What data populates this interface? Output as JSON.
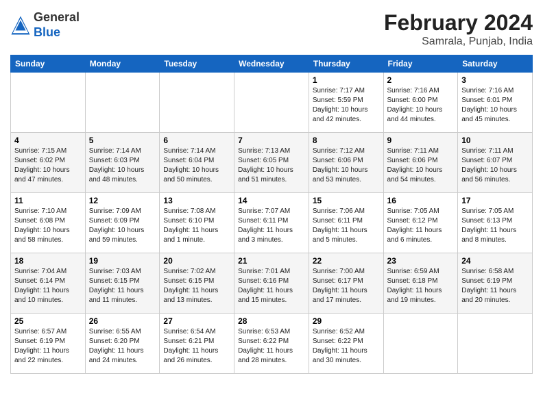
{
  "header": {
    "logo_line1": "General",
    "logo_line2": "Blue",
    "month_year": "February 2024",
    "location": "Samrala, Punjab, India"
  },
  "weekdays": [
    "Sunday",
    "Monday",
    "Tuesday",
    "Wednesday",
    "Thursday",
    "Friday",
    "Saturday"
  ],
  "weeks": [
    [
      {
        "day": "",
        "info": ""
      },
      {
        "day": "",
        "info": ""
      },
      {
        "day": "",
        "info": ""
      },
      {
        "day": "",
        "info": ""
      },
      {
        "day": "1",
        "info": "Sunrise: 7:17 AM\nSunset: 5:59 PM\nDaylight: 10 hours\nand 42 minutes."
      },
      {
        "day": "2",
        "info": "Sunrise: 7:16 AM\nSunset: 6:00 PM\nDaylight: 10 hours\nand 44 minutes."
      },
      {
        "day": "3",
        "info": "Sunrise: 7:16 AM\nSunset: 6:01 PM\nDaylight: 10 hours\nand 45 minutes."
      }
    ],
    [
      {
        "day": "4",
        "info": "Sunrise: 7:15 AM\nSunset: 6:02 PM\nDaylight: 10 hours\nand 47 minutes."
      },
      {
        "day": "5",
        "info": "Sunrise: 7:14 AM\nSunset: 6:03 PM\nDaylight: 10 hours\nand 48 minutes."
      },
      {
        "day": "6",
        "info": "Sunrise: 7:14 AM\nSunset: 6:04 PM\nDaylight: 10 hours\nand 50 minutes."
      },
      {
        "day": "7",
        "info": "Sunrise: 7:13 AM\nSunset: 6:05 PM\nDaylight: 10 hours\nand 51 minutes."
      },
      {
        "day": "8",
        "info": "Sunrise: 7:12 AM\nSunset: 6:06 PM\nDaylight: 10 hours\nand 53 minutes."
      },
      {
        "day": "9",
        "info": "Sunrise: 7:11 AM\nSunset: 6:06 PM\nDaylight: 10 hours\nand 54 minutes."
      },
      {
        "day": "10",
        "info": "Sunrise: 7:11 AM\nSunset: 6:07 PM\nDaylight: 10 hours\nand 56 minutes."
      }
    ],
    [
      {
        "day": "11",
        "info": "Sunrise: 7:10 AM\nSunset: 6:08 PM\nDaylight: 10 hours\nand 58 minutes."
      },
      {
        "day": "12",
        "info": "Sunrise: 7:09 AM\nSunset: 6:09 PM\nDaylight: 10 hours\nand 59 minutes."
      },
      {
        "day": "13",
        "info": "Sunrise: 7:08 AM\nSunset: 6:10 PM\nDaylight: 11 hours\nand 1 minute."
      },
      {
        "day": "14",
        "info": "Sunrise: 7:07 AM\nSunset: 6:11 PM\nDaylight: 11 hours\nand 3 minutes."
      },
      {
        "day": "15",
        "info": "Sunrise: 7:06 AM\nSunset: 6:11 PM\nDaylight: 11 hours\nand 5 minutes."
      },
      {
        "day": "16",
        "info": "Sunrise: 7:05 AM\nSunset: 6:12 PM\nDaylight: 11 hours\nand 6 minutes."
      },
      {
        "day": "17",
        "info": "Sunrise: 7:05 AM\nSunset: 6:13 PM\nDaylight: 11 hours\nand 8 minutes."
      }
    ],
    [
      {
        "day": "18",
        "info": "Sunrise: 7:04 AM\nSunset: 6:14 PM\nDaylight: 11 hours\nand 10 minutes."
      },
      {
        "day": "19",
        "info": "Sunrise: 7:03 AM\nSunset: 6:15 PM\nDaylight: 11 hours\nand 11 minutes."
      },
      {
        "day": "20",
        "info": "Sunrise: 7:02 AM\nSunset: 6:15 PM\nDaylight: 11 hours\nand 13 minutes."
      },
      {
        "day": "21",
        "info": "Sunrise: 7:01 AM\nSunset: 6:16 PM\nDaylight: 11 hours\nand 15 minutes."
      },
      {
        "day": "22",
        "info": "Sunrise: 7:00 AM\nSunset: 6:17 PM\nDaylight: 11 hours\nand 17 minutes."
      },
      {
        "day": "23",
        "info": "Sunrise: 6:59 AM\nSunset: 6:18 PM\nDaylight: 11 hours\nand 19 minutes."
      },
      {
        "day": "24",
        "info": "Sunrise: 6:58 AM\nSunset: 6:19 PM\nDaylight: 11 hours\nand 20 minutes."
      }
    ],
    [
      {
        "day": "25",
        "info": "Sunrise: 6:57 AM\nSunset: 6:19 PM\nDaylight: 11 hours\nand 22 minutes."
      },
      {
        "day": "26",
        "info": "Sunrise: 6:55 AM\nSunset: 6:20 PM\nDaylight: 11 hours\nand 24 minutes."
      },
      {
        "day": "27",
        "info": "Sunrise: 6:54 AM\nSunset: 6:21 PM\nDaylight: 11 hours\nand 26 minutes."
      },
      {
        "day": "28",
        "info": "Sunrise: 6:53 AM\nSunset: 6:22 PM\nDaylight: 11 hours\nand 28 minutes."
      },
      {
        "day": "29",
        "info": "Sunrise: 6:52 AM\nSunset: 6:22 PM\nDaylight: 11 hours\nand 30 minutes."
      },
      {
        "day": "",
        "info": ""
      },
      {
        "day": "",
        "info": ""
      }
    ]
  ]
}
